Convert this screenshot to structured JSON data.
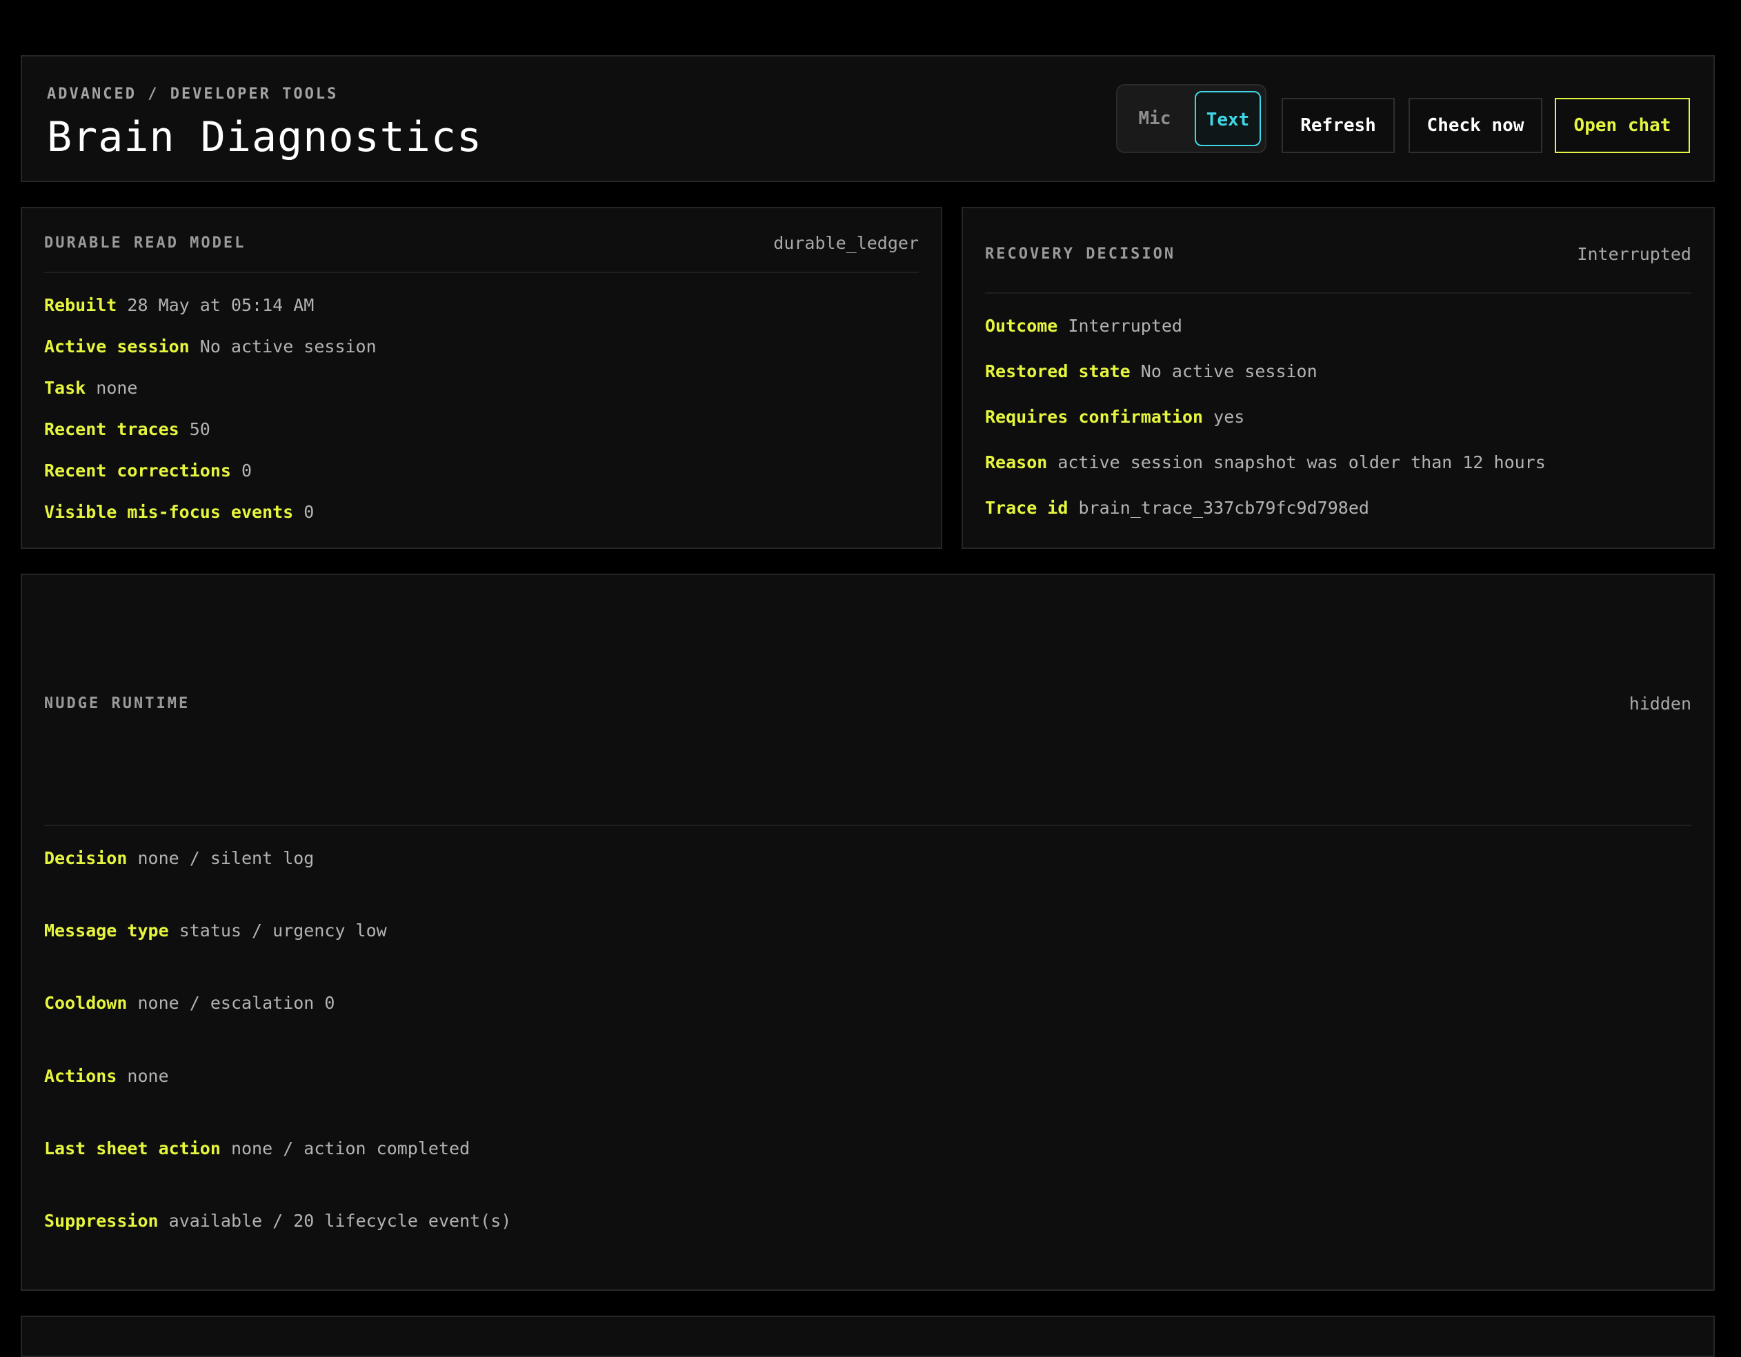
{
  "header": {
    "breadcrumb": "ADVANCED / DEVELOPER TOOLS",
    "title": "Brain Diagnostics",
    "mode_toggle": {
      "mic_label": "Mic",
      "text_label": "Text",
      "selected": "Text"
    },
    "refresh_label": "Refresh",
    "check_now_label": "Check now",
    "open_chat_label": "Open chat"
  },
  "durable_read_model": {
    "title": "DURABLE READ MODEL",
    "tag": "durable_ledger",
    "rows": [
      {
        "label": "Rebuilt",
        "value": "28 May at 05:14 AM"
      },
      {
        "label": "Active session",
        "value": "No active session"
      },
      {
        "label": "Task",
        "value": "none"
      },
      {
        "label": "Recent traces",
        "value": "50"
      },
      {
        "label": "Recent corrections",
        "value": "0"
      },
      {
        "label": "Visible mis-focus events",
        "value": "0"
      }
    ]
  },
  "recovery_decision": {
    "title": "RECOVERY DECISION",
    "tag": "Interrupted",
    "rows": [
      {
        "label": "Outcome",
        "value": "Interrupted"
      },
      {
        "label": "Restored state",
        "value": "No active session"
      },
      {
        "label": "Requires confirmation",
        "value": "yes"
      },
      {
        "label": "Reason",
        "value": "active session snapshot was older than 12 hours"
      },
      {
        "label": "Trace id",
        "value": "brain_trace_337cb79fc9d798ed"
      }
    ]
  },
  "nudge_runtime": {
    "title": "NUDGE RUNTIME",
    "tag": "hidden",
    "rows": [
      {
        "label": "Decision",
        "value": "none / silent log"
      },
      {
        "label": "Message type",
        "value": "status / urgency low"
      },
      {
        "label": "Cooldown",
        "value": "none / escalation 0"
      },
      {
        "label": "Actions",
        "value": "none"
      },
      {
        "label": "Last sheet action",
        "value": "none / action completed"
      },
      {
        "label": "Suppression",
        "value": "available / 20 lifecycle event(s)"
      }
    ]
  },
  "colors": {
    "accent_yellow": "#e6f53d",
    "accent_cyan": "#3fd7e6",
    "background": "#000000",
    "panel": "#0e0e0e"
  }
}
